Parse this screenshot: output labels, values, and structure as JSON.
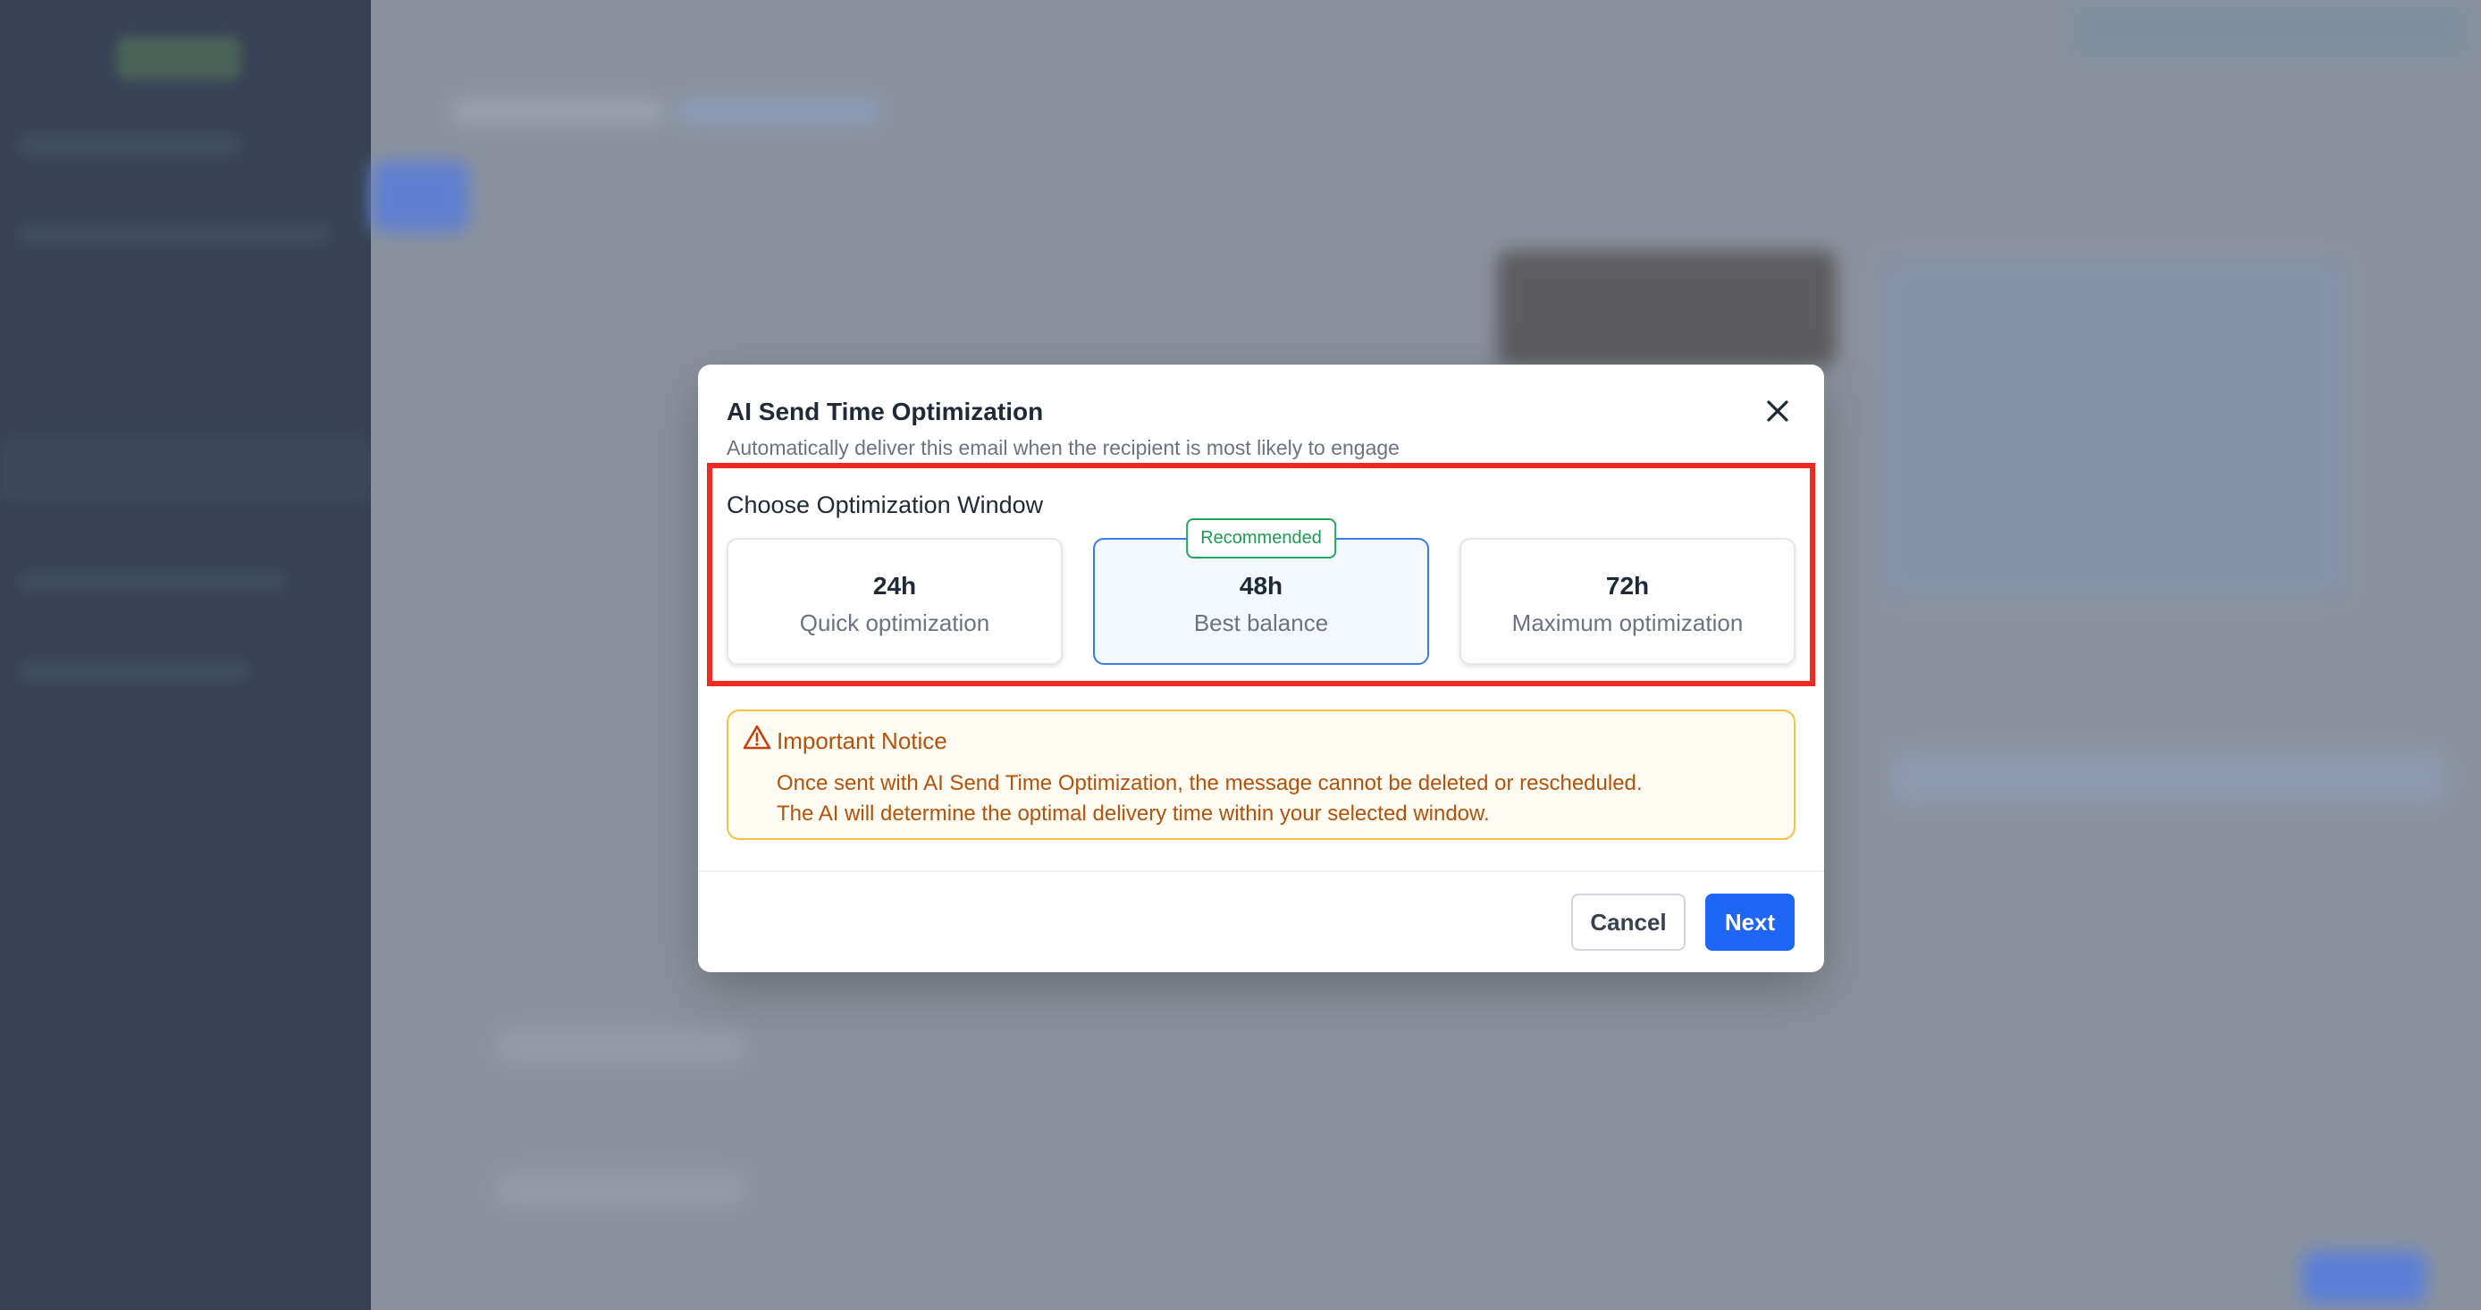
{
  "modal": {
    "title": "AI Send Time Optimization",
    "subtitle": "Automatically deliver this email when the recipient is most likely to engage",
    "section_title": "Choose Optimization Window",
    "options": [
      {
        "value": "24h",
        "label": "Quick optimization",
        "selected": false
      },
      {
        "value": "48h",
        "label": "Best balance",
        "selected": true,
        "badge": "Recommended"
      },
      {
        "value": "72h",
        "label": "Maximum optimization",
        "selected": false
      }
    ],
    "notice": {
      "title": "Important Notice",
      "line1": "Once sent with AI Send Time Optimization, the message cannot be deleted or rescheduled.",
      "line2": "The AI will determine the optimal delivery time within your selected window."
    },
    "cancel_label": "Cancel",
    "next_label": "Next"
  },
  "icons": {
    "close": "close-icon",
    "warning": "warning-triangle-icon"
  },
  "colors": {
    "primary": "#1e66f5",
    "selected_border": "#3b7be6",
    "recommended": "#1f9a52",
    "warning_text": "#b4510a",
    "warning_border": "#f5c043",
    "highlight_box": "#ef2a23"
  }
}
